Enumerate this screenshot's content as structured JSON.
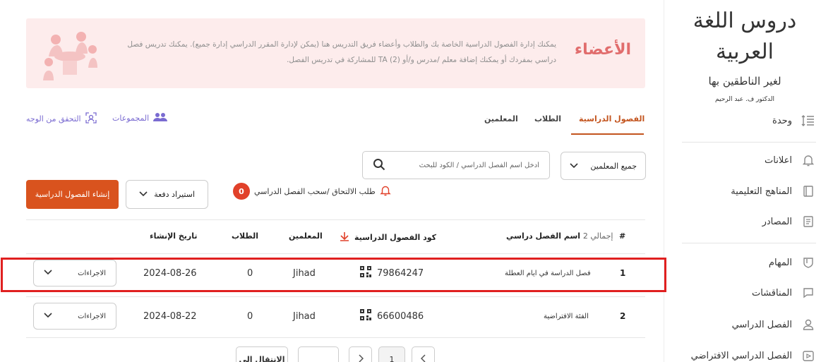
{
  "sidebar": {
    "logo": {
      "line1": "دروس اللغة العربية",
      "line2": "لغير الناطقين بها",
      "line3": "الدكتور ف. عبد الرحيم"
    },
    "items": [
      {
        "label": "وحدة",
        "icon": "list-icon"
      },
      {
        "label": "اعلانات",
        "icon": "bell-icon"
      },
      {
        "label": "المناهج التعليمية",
        "icon": "book-icon"
      },
      {
        "label": "المصادر",
        "icon": "document-icon"
      },
      {
        "label": "المهام",
        "icon": "shield-icon"
      },
      {
        "label": "المناقشات",
        "icon": "chat-icon"
      },
      {
        "label": "الفصل الدراسي",
        "icon": "user-icon"
      },
      {
        "label": "الفصل الدراسي الافتراضي",
        "icon": "video-icon"
      }
    ]
  },
  "banner": {
    "title": "الأعضاء",
    "text": "يمكنك إدارة الفصول الدراسية الخاصة بك والطلاب وأعضاء فريق التدريس هنا (يمكن لإدارة المقرر الدراسي إدارة جميع). يمكنك تدريس فصل دراسي بمفردك أو يمكنك إضافة معلم /مدرس و/أو (2) TA للمشاركة في تدريس الفصل."
  },
  "tabs": {
    "classes": "الفصول الدراسية",
    "students": "الطلاب",
    "teachers": "المعلمين",
    "groups": "المجموعات",
    "face_verify": "التحقق من الوجه"
  },
  "filters": {
    "teacher_select": "جميع المعلمين",
    "search_placeholder": "أدخل اسم الفصل الدراسي / الكود للبحث",
    "join_requests": "طلب الالتحاق /سحب الفصل الدراسي",
    "join_requests_count": "0",
    "import": "استيراد دفعة",
    "create": "إنشاء الفصول الدراسية"
  },
  "table": {
    "headers": {
      "num": "#",
      "name": "اسم الفصل دراسي",
      "total": "إجمالي 2",
      "code": "كود الفصول الدراسية",
      "teachers": "المعلمين",
      "students": "الطلاب",
      "created": "تاريخ الإنشاء"
    },
    "actions_label": "الاجراءات",
    "rows": [
      {
        "num": "1",
        "name": "فصل الدراسة في ايام العطلة",
        "code": "79864247",
        "teacher": "Jihad",
        "students": "0",
        "date": "2024-08-26"
      },
      {
        "num": "2",
        "name": "الفئة الافتراضية",
        "code": "66600486",
        "teacher": "Jihad",
        "students": "0",
        "date": "2024-08-22"
      }
    ]
  },
  "pagination": {
    "current": "1",
    "jump": "الانتقال إلى"
  },
  "colors": {
    "accent": "#d9531e",
    "tab_active": "#c3541e",
    "link": "#7a6bd1",
    "highlight": "#e02020",
    "banner_bg": "#fdecec"
  }
}
